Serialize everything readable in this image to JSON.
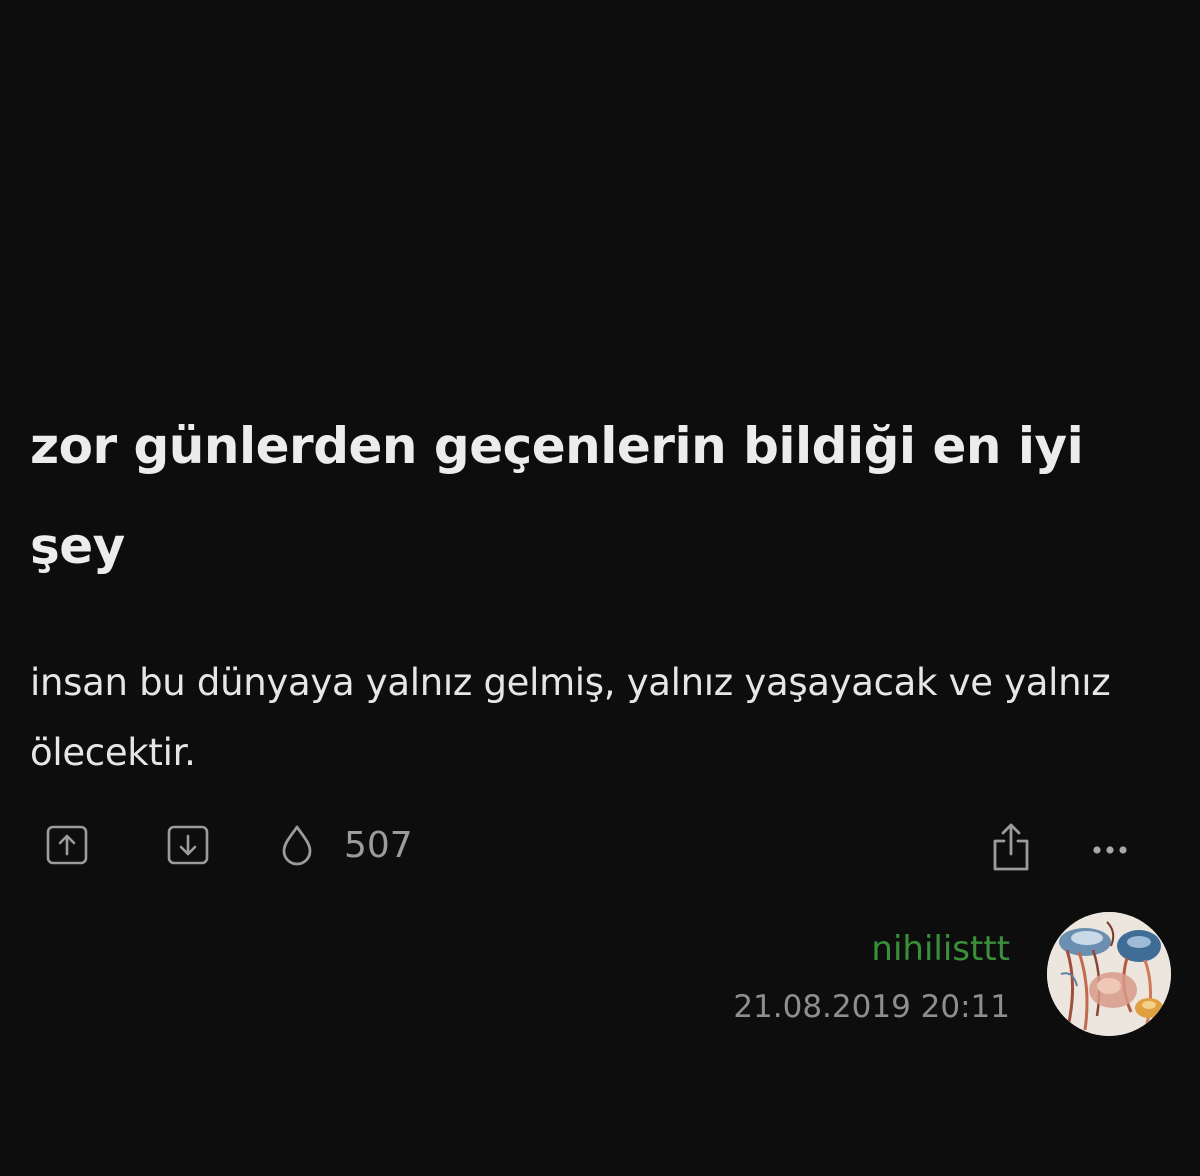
{
  "entry": {
    "title": "zor günlerden geçenlerin bildiği en iyi şey",
    "content": "insan bu dünyaya yalnız gelmiş, yalnız yaşayacak ve yalnız ölecektir.",
    "favorite_count": "507",
    "author": "nihilisttt",
    "date": "21.08.2019 20:11"
  },
  "actions": {
    "icons": [
      "upvote-icon",
      "downvote-icon",
      "favorite-drop-icon",
      "share-icon",
      "more-options-icon"
    ]
  },
  "colors": {
    "background": "#0d0d0d",
    "text": "#ececec",
    "icon": "#9c9c9c",
    "author": "#3a8f3a",
    "date": "#8e8e8e"
  }
}
